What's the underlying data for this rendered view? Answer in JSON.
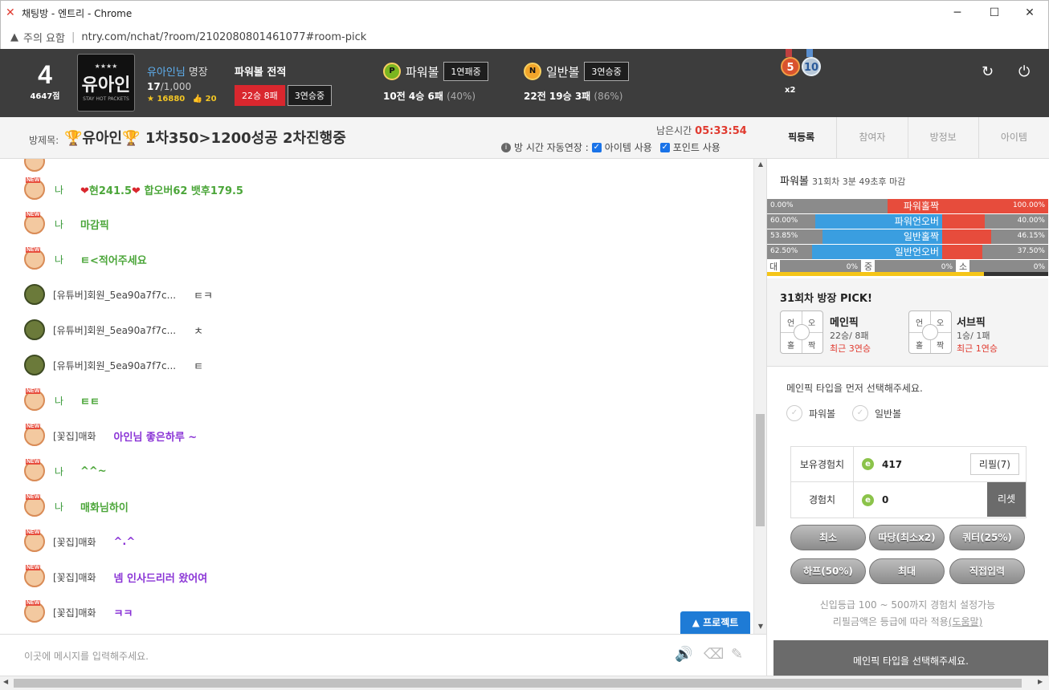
{
  "window": {
    "title": "채팅방 - 엔트리 - Chrome",
    "minimize": "─",
    "maximize": "☐",
    "close": "✕"
  },
  "address": {
    "warning_icon": "warning-icon",
    "warning": "주의 요함",
    "separator": "|",
    "url": "ntry.com/nchat/?room/2102080801461077#room-pick"
  },
  "user": {
    "level": "4",
    "points": "4647점",
    "avatar_stars": "★★★★",
    "avatar_name": "유아인",
    "avatar_sub": "STAY HOT PACKETS",
    "name": "유아인님",
    "rank": "명장",
    "count": "17",
    "count_total": "/1,000",
    "star_score": "16880",
    "thumb_score": "20"
  },
  "powerball_record": {
    "title": "파워볼 전적",
    "record": "22승 8패",
    "streak": "3연승중"
  },
  "balls": [
    {
      "letter": "P",
      "name": "파워볼",
      "streak": "1연패중",
      "record": "10전 4승 6패",
      "pct": "(40%)"
    },
    {
      "letter": "N",
      "name": "일반볼",
      "streak": "3연승중",
      "record": "22전 19승 3패",
      "pct": "(86%)"
    }
  ],
  "medals": {
    "a": "5",
    "b": "10",
    "mult": "x2"
  },
  "header_icons": {
    "refresh": "↻",
    "power": "⏻"
  },
  "room": {
    "label": "방제목:",
    "title": "유아인",
    "subtitle": "1차350>1200성공 2차진행중",
    "remain_label": "남은시간",
    "remain": "05:33:54",
    "auto_extend": "방 시간 자동연장 :",
    "opt_item": "아이템 사용",
    "opt_point": "포인트 사용"
  },
  "tabs": [
    "픽등록",
    "참여자",
    "방정보",
    "아이템"
  ],
  "messages": [
    {
      "nick": "나",
      "parts": [
        "현241.5",
        "합오버62 뱃후179.5"
      ],
      "kind": "me"
    },
    {
      "nick": "나",
      "text": "마감픽",
      "kind": "me"
    },
    {
      "nick": "나",
      "text": "ㅌ<적어주세요",
      "kind": "me"
    },
    {
      "nick": "[유튜버]회원_5ea90a7f7c...",
      "text": "ㅌㅋ",
      "kind": "you"
    },
    {
      "nick": "[유튜버]회원_5ea90a7f7c...",
      "text": "ㅊ",
      "kind": "you"
    },
    {
      "nick": "[유튜버]회원_5ea90a7f7c...",
      "text": "ㅌ",
      "kind": "you"
    },
    {
      "nick": "나",
      "text": "ㅌㅌ",
      "kind": "me"
    },
    {
      "nick": "[꽃집]매화",
      "text": "아인님 좋은하루 ~",
      "kind": "flower"
    },
    {
      "nick": "나",
      "text": "^^~",
      "kind": "me"
    },
    {
      "nick": "나",
      "text": "매화님하이",
      "kind": "me"
    },
    {
      "nick": "[꽃집]매화",
      "text": "^.^",
      "kind": "flower"
    },
    {
      "nick": "[꽃집]매화",
      "text": "넴 인사드리러 왔어여",
      "kind": "flower"
    },
    {
      "nick": "[꽃집]매화",
      "text": "ㅋㅋ",
      "kind": "flower"
    }
  ],
  "project_button": "▲ 프로젝트",
  "input_placeholder": "이곳에 메시지를 입력해주세요.",
  "panel": {
    "round_title": "파워볼",
    "round_info": "31회차 3분 49초후 마감",
    "stats": [
      {
        "left_pct": 0.0,
        "left": "0.00%",
        "label": "파워홀짝",
        "right_pct": 100.0,
        "right": "100.00%"
      },
      {
        "left_pct": 60.0,
        "left": "60.00%",
        "label": "파워언오버",
        "right_pct": 40.0,
        "right": "40.00%"
      },
      {
        "left_pct": 53.85,
        "left": "53.85%",
        "label": "일반홀짝",
        "right_pct": 46.15,
        "right": "46.15%"
      },
      {
        "left_pct": 62.5,
        "left": "62.50%",
        "label": "일반언오버",
        "right_pct": 37.5,
        "right": "37.50%"
      }
    ],
    "dzs": [
      {
        "label": "대",
        "pct": "0%"
      },
      {
        "label": "중",
        "pct": "0%"
      },
      {
        "label": "소",
        "pct": "0%"
      }
    ],
    "gauge_level": 0.77,
    "pick_title": "31회차 방장 PICK!",
    "picker_labels": [
      "언",
      "오",
      "홀",
      "짝"
    ],
    "main_pick": {
      "title": "메인픽",
      "record": "22승/ 8패",
      "recent": "최근 3연승"
    },
    "sub_pick": {
      "title": "서브픽",
      "record": "1승/ 1패",
      "recent": "최근 1연승"
    },
    "guide": "메인픽 타입을 먼저 선택해주세요.",
    "radio1": "파워볼",
    "radio2": "일반볼",
    "held_exp_label": "보유경험치",
    "held_exp": "417",
    "refill": "리필(7)",
    "exp_label": "경험치",
    "exp": "0",
    "reset": "리셋",
    "coin": "e",
    "bets": [
      "최소",
      "따당(최소x2)",
      "쿼터(25%)",
      "하프(50%)",
      "최대",
      "직접입력"
    ],
    "note1": "신입등급 100 ~ 500까지 경험치 설정가능",
    "note2": "리필금액은 등급에 따라 적용",
    "note2_link": "(도움말)",
    "submit": "메인픽 타입을 선택해주세요."
  },
  "colors": {
    "header": "#3d3d3d",
    "me": "#4ca63a",
    "flower": "#8a34d6",
    "accent": "#1e7bd6",
    "red": "#e74c3c",
    "blue": "#3a9ee0"
  }
}
